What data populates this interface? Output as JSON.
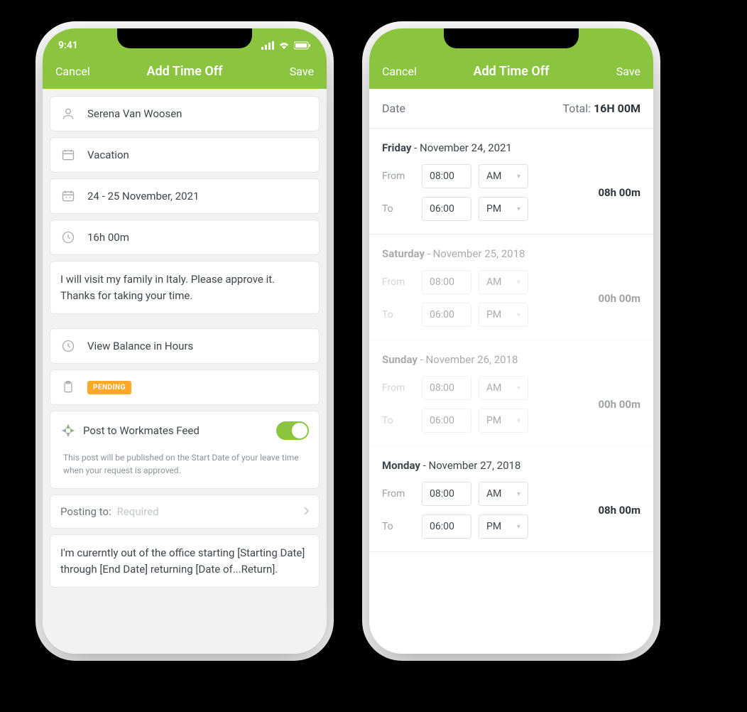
{
  "status": {
    "time": "9:41"
  },
  "nav": {
    "cancel": "Cancel",
    "title": "Add Time Off",
    "save": "Save"
  },
  "left": {
    "user": "Serena Van Woosen",
    "type": "Vacation",
    "dates": "24 - 25 November, 2021",
    "duration": "16h 00m",
    "note": "I will visit my family in Italy. Please approve it. Thanks for taking your time.",
    "balance": "View Balance in Hours",
    "status_badge": "PENDING",
    "feed_label": "Post to Workmates Feed",
    "feed_hint": "This post will be published on the Start Date of your leave time when your request is approved.",
    "posting_label": "Posting to:",
    "posting_value": "Required",
    "message": "I'm curerntly out of the office starting [Starting Date] through [End Date] returning [Date of...Return]."
  },
  "right": {
    "date_label": "Date",
    "total_label": "Total:",
    "total_value": "16H 00M",
    "days": [
      {
        "dow": "Friday",
        "date": "November 24, 2021",
        "from": "08:00",
        "from_ap": "AM",
        "to": "06:00",
        "to_ap": "PM",
        "total": "08h 00m",
        "disabled": false
      },
      {
        "dow": "Saturday",
        "date": "November 25, 2018",
        "from": "08:00",
        "from_ap": "AM",
        "to": "06:00",
        "to_ap": "PM",
        "total": "00h 00m",
        "disabled": true
      },
      {
        "dow": "Sunday",
        "date": "November 26, 2018",
        "from": "08:00",
        "from_ap": "AM",
        "to": "06:00",
        "to_ap": "PM",
        "total": "00h 00m",
        "disabled": true
      },
      {
        "dow": "Monday",
        "date": "November 27, 2018",
        "from": "08:00",
        "from_ap": "AM",
        "to": "06:00",
        "to_ap": "PM",
        "total": "08h 00m",
        "disabled": false
      }
    ],
    "from_lbl": "From",
    "to_lbl": "To"
  }
}
